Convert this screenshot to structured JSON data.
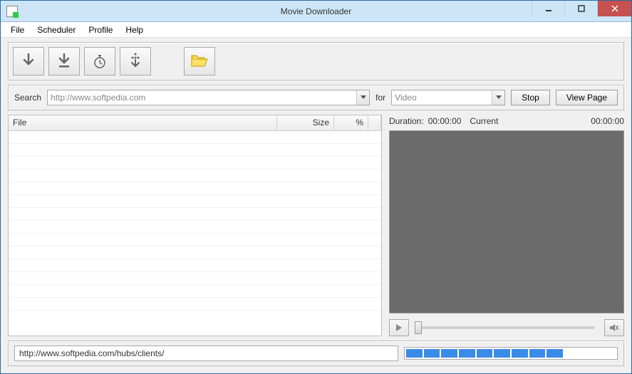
{
  "window": {
    "title": "Movie Downloader"
  },
  "menu": {
    "file": "File",
    "scheduler": "Scheduler",
    "profile": "Profile",
    "help": "Help"
  },
  "toolbar": {
    "download": "download",
    "download_all": "download-all",
    "scheduler": "scheduler",
    "queue": "queue",
    "open_folder": "open-folder"
  },
  "search": {
    "label": "Search",
    "url": "http://www.softpedia.com",
    "for_label": "for",
    "type": "Video",
    "stop": "Stop",
    "view_page": "View Page"
  },
  "table": {
    "cols": {
      "file": "File",
      "size": "Size",
      "pct": "%"
    },
    "rows": []
  },
  "preview": {
    "duration_label": "Duration:",
    "duration_value": "00:00:00",
    "current_label": "Current",
    "current_value": "00:00:00"
  },
  "status": {
    "url": "http://www.softpedia.com/hubs/clients/",
    "progress_segments": 12,
    "progress_filled": 9
  }
}
